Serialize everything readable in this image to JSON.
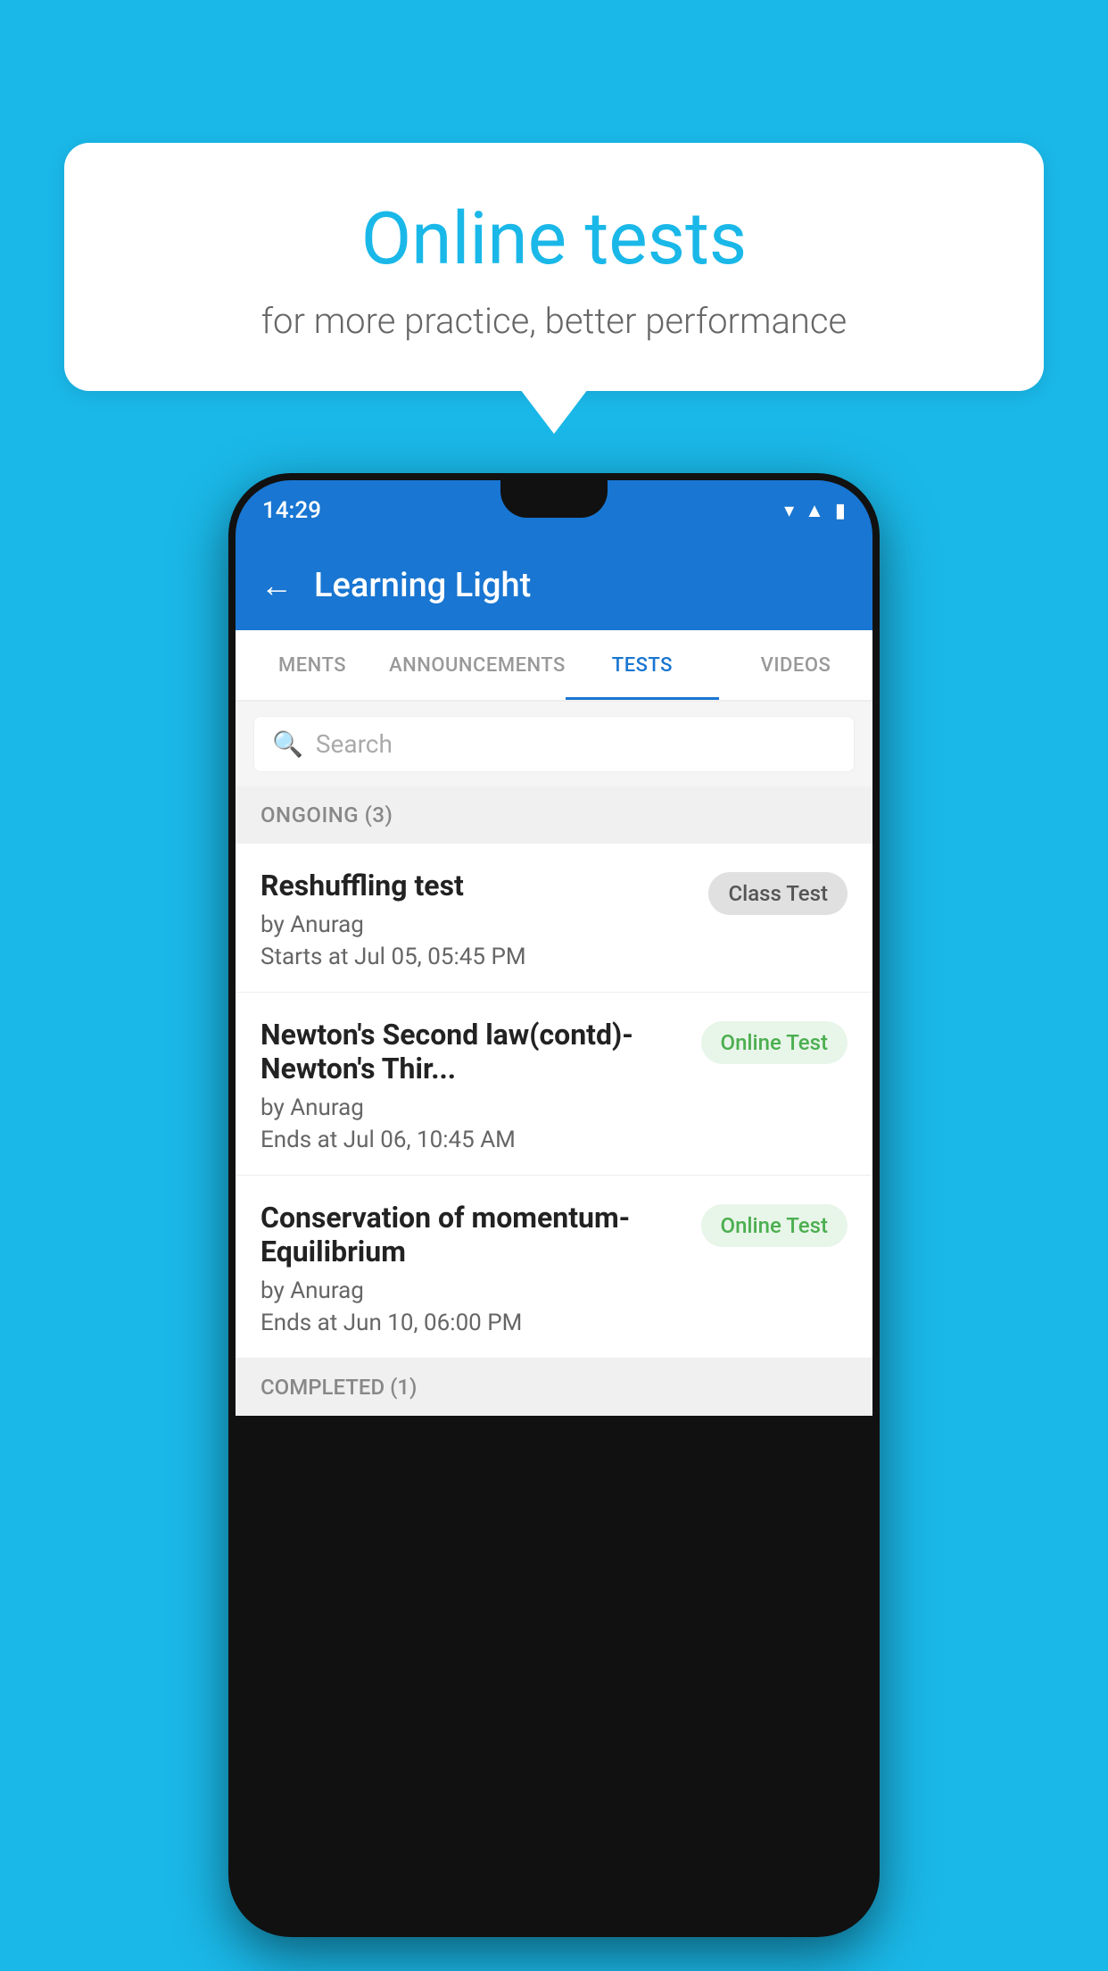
{
  "background_color": "#1ab8e8",
  "bubble": {
    "title": "Online tests",
    "subtitle": "for more practice, better performance"
  },
  "phone": {
    "status_bar": {
      "time": "14:29",
      "icons": [
        "wifi",
        "signal",
        "battery"
      ]
    },
    "app_bar": {
      "back_label": "←",
      "title": "Learning Light"
    },
    "tabs": [
      {
        "label": "MENTS",
        "active": false
      },
      {
        "label": "ANNOUNCEMENTS",
        "active": false
      },
      {
        "label": "TESTS",
        "active": true
      },
      {
        "label": "VIDEOS",
        "active": false
      }
    ],
    "search": {
      "placeholder": "Search"
    },
    "sections": [
      {
        "header": "ONGOING (3)",
        "items": [
          {
            "name": "Reshuffling test",
            "by": "by Anurag",
            "time": "Starts at  Jul 05, 05:45 PM",
            "badge": "Class Test",
            "badge_type": "class"
          },
          {
            "name": "Newton's Second law(contd)-Newton's Thir...",
            "by": "by Anurag",
            "time": "Ends at  Jul 06, 10:45 AM",
            "badge": "Online Test",
            "badge_type": "online"
          },
          {
            "name": "Conservation of momentum-Equilibrium",
            "by": "by Anurag",
            "time": "Ends at  Jun 10, 06:00 PM",
            "badge": "Online Test",
            "badge_type": "online"
          }
        ]
      }
    ],
    "completed_section": "COMPLETED (1)"
  }
}
